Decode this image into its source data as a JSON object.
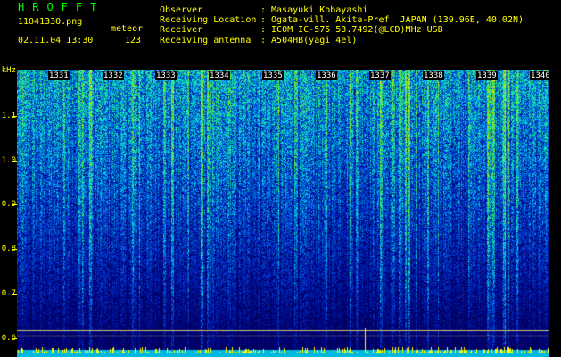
{
  "header": {
    "app_title": "HROFFT",
    "filename": "11041330.png",
    "datetime": "02.11.04 13:30",
    "meteor_label": "meteor",
    "meteor_count": "123",
    "fields": [
      {
        "label": "Observer",
        "value": ": Masayuki Kobayashi"
      },
      {
        "label": "Receiving Location",
        "value": ": Ogata-vill. Akita-Pref. JAPAN (139.96E, 40.02N)"
      },
      {
        "label": "Receiver",
        "value": ": ICOM IC-575 53.7492(@LCD)MHz USB"
      },
      {
        "label": "Receiving antenna",
        "value": ": A504HB(yagi 4el)"
      }
    ]
  },
  "frequency_axis": {
    "unit": "kHz",
    "ticks": [
      "1.1",
      "1.0",
      "0.9",
      "0.8",
      "0.7",
      "0.6"
    ]
  },
  "time_axis": {
    "ticks": [
      "1331",
      "1332",
      "1333",
      "1334",
      "1335",
      "1336",
      "1337",
      "1338",
      "1339",
      "1340"
    ]
  },
  "colors": {
    "text_green": "#00ff00",
    "text_yellow": "#ffff00",
    "background": "#000000",
    "spectrogram_low": "#000060",
    "spectrogram_high": "#00ffd0"
  }
}
